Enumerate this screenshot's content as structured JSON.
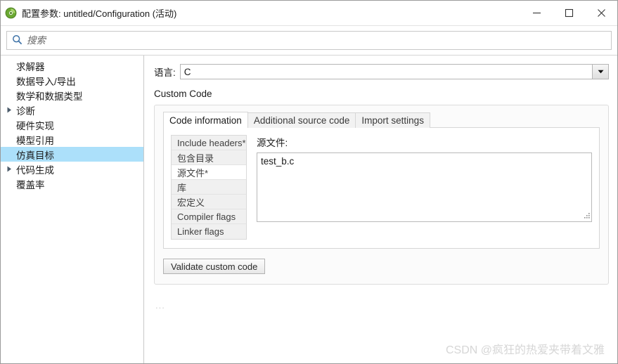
{
  "window": {
    "title": "配置参数: untitled/Configuration (活动)",
    "app_icon": "simulink-config-icon",
    "controls": {
      "minimize": "minimize-icon",
      "maximize": "maximize-icon",
      "close": "close-icon"
    }
  },
  "search": {
    "icon": "search-icon",
    "placeholder": "搜索",
    "value": ""
  },
  "sidebar": {
    "items": [
      {
        "label": "求解器",
        "expandable": false,
        "selected": false
      },
      {
        "label": "数据导入/导出",
        "expandable": false,
        "selected": false
      },
      {
        "label": "数学和数据类型",
        "expandable": false,
        "selected": false
      },
      {
        "label": "诊断",
        "expandable": true,
        "selected": false
      },
      {
        "label": "硬件实现",
        "expandable": false,
        "selected": false
      },
      {
        "label": "模型引用",
        "expandable": false,
        "selected": false
      },
      {
        "label": "仿真目标",
        "expandable": false,
        "selected": true
      },
      {
        "label": "代码生成",
        "expandable": true,
        "selected": false
      },
      {
        "label": "覆盖率",
        "expandable": false,
        "selected": false
      }
    ]
  },
  "main": {
    "language": {
      "label": "语言:",
      "value": "C",
      "arrow_icon": "chevron-down-icon"
    },
    "group_label": "Custom Code",
    "tabs": [
      {
        "label": "Code information",
        "active": true
      },
      {
        "label": "Additional source code",
        "active": false
      },
      {
        "label": "Import settings",
        "active": false
      }
    ],
    "property_list": [
      {
        "label": "Include headers*",
        "selected": false
      },
      {
        "label": "包含目录",
        "selected": false
      },
      {
        "label": "源文件*",
        "selected": true
      },
      {
        "label": "库",
        "selected": false
      },
      {
        "label": "宏定义",
        "selected": false
      },
      {
        "label": "Compiler flags",
        "selected": false
      },
      {
        "label": "Linker flags",
        "selected": false
      }
    ],
    "editor": {
      "label": "源文件:",
      "value": "test_b.c",
      "grip_icon": "resize-grip-icon"
    },
    "validate_button": "Validate custom code",
    "footer_ellipsis": "..."
  },
  "watermark": "CSDN @疯狂的热爱夹带着文雅",
  "colors": {
    "selection": "#ace0fa",
    "window_border": "#9a9a9a",
    "panel_border": "#dcdcdc",
    "watermark": "#d6d6d6"
  }
}
